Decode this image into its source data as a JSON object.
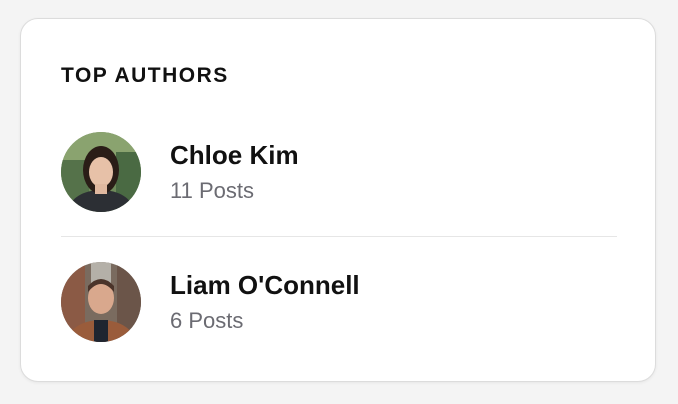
{
  "widget": {
    "title": "TOP AUTHORS"
  },
  "authors": [
    {
      "name": "Chloe Kim",
      "posts": "11 Posts",
      "avatar_icon": "avatar-chloe-kim"
    },
    {
      "name": "Liam O'Connell",
      "posts": "6 Posts",
      "avatar_icon": "avatar-liam-oconnell"
    }
  ],
  "colors": {
    "page_background": "#f4f4f4",
    "card_background": "#ffffff",
    "card_border": "#dcdcdc",
    "title_text": "#111111",
    "secondary_text": "#6b6b72",
    "divider": "#e6e6e6"
  }
}
